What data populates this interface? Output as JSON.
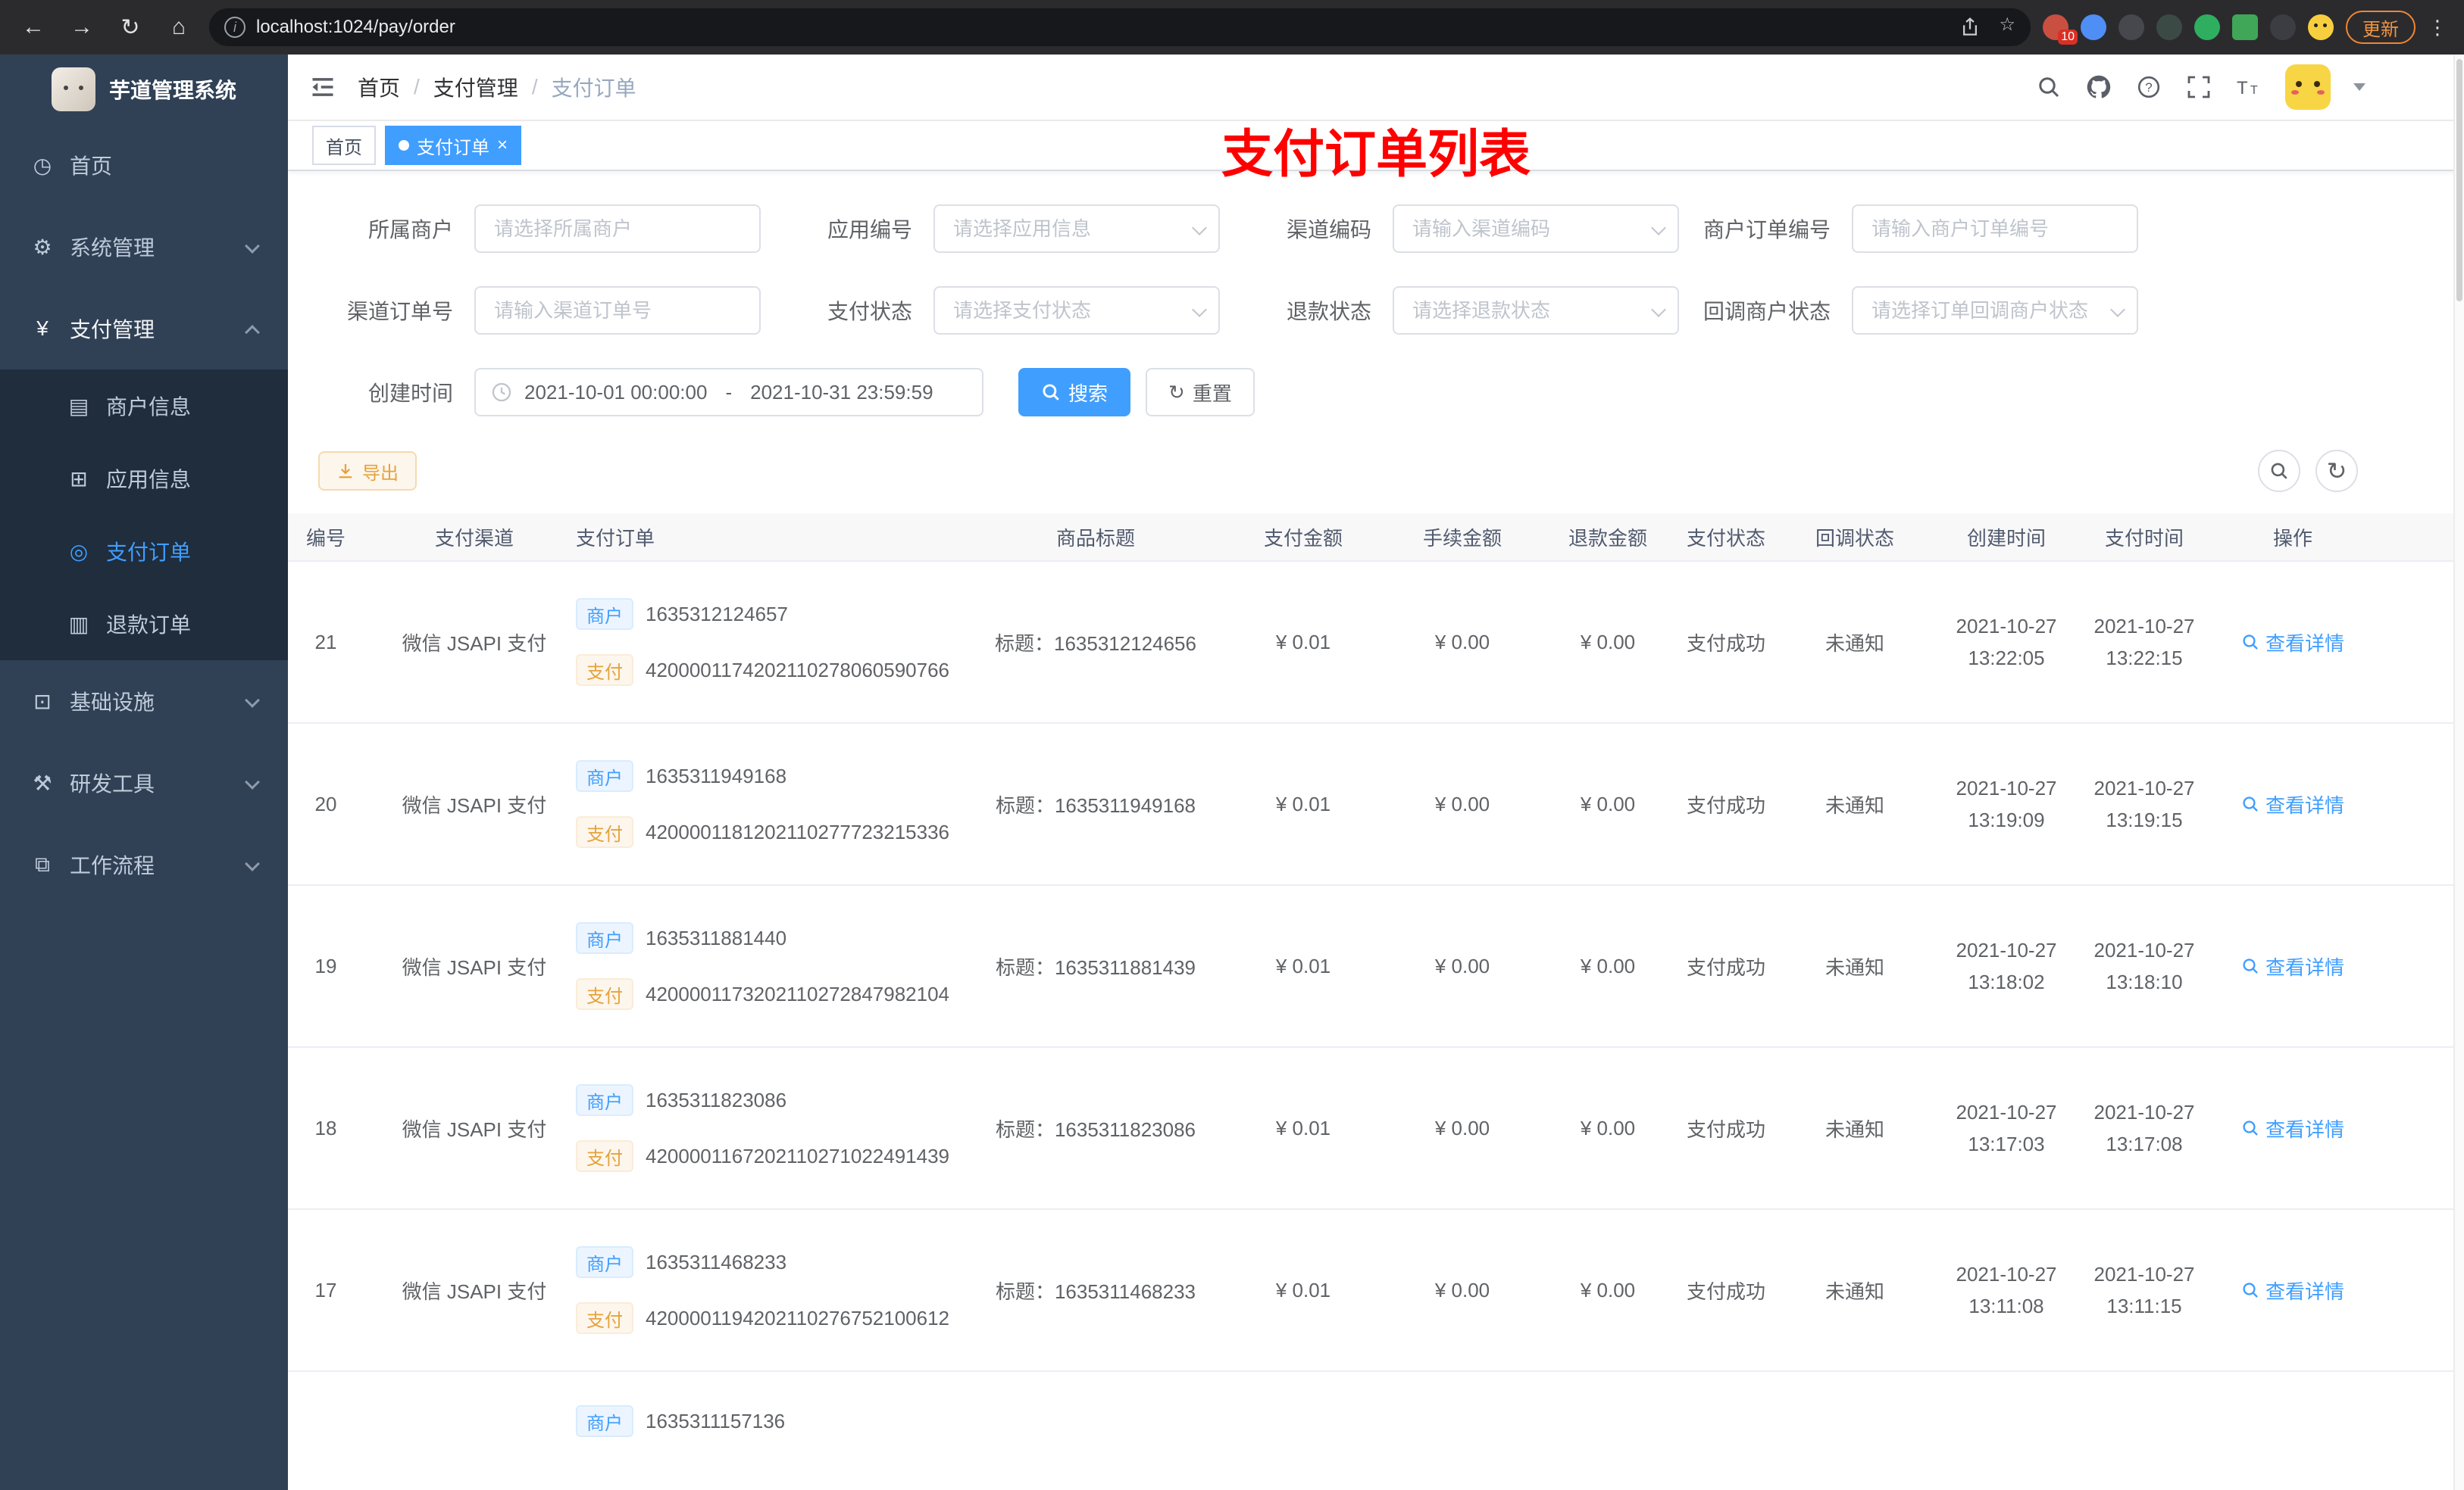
{
  "browser": {
    "url": "localhost:1024/pay/order",
    "update_label": "更新",
    "extension_badge": "10"
  },
  "sidebar": {
    "title": "芋道管理系统",
    "menu": [
      {
        "label": "首页"
      },
      {
        "label": "系统管理"
      },
      {
        "label": "支付管理"
      },
      {
        "label": "基础设施"
      },
      {
        "label": "研发工具"
      },
      {
        "label": "工作流程"
      }
    ],
    "submenu": [
      {
        "label": "商户信息"
      },
      {
        "label": "应用信息"
      },
      {
        "label": "支付订单"
      },
      {
        "label": "退款订单"
      }
    ]
  },
  "navbar": {
    "breadcrumb": [
      "首页",
      "支付管理",
      "支付订单"
    ],
    "annotation": "支付订单列表"
  },
  "tabs": [
    {
      "label": "首页"
    },
    {
      "label": "支付订单"
    }
  ],
  "filters": {
    "fields": [
      {
        "label": "所属商户",
        "placeholder": "请选择所属商户"
      },
      {
        "label": "应用编号",
        "placeholder": "请选择应用信息"
      },
      {
        "label": "渠道编码",
        "placeholder": "请输入渠道编码"
      },
      {
        "label": "商户订单编号",
        "placeholder": "请输入商户订单编号"
      },
      {
        "label": "渠道订单号",
        "placeholder": "请输入渠道订单号"
      },
      {
        "label": "支付状态",
        "placeholder": "请选择支付状态"
      },
      {
        "label": "退款状态",
        "placeholder": "请选择退款状态"
      },
      {
        "label": "回调商户状态",
        "placeholder": "请选择订单回调商户状态"
      }
    ],
    "create_time_label": "创建时间",
    "date_start": "2021-10-01 00:00:00",
    "date_separator": "-",
    "date_end": "2021-10-31 23:59:59",
    "search_label": "搜索",
    "reset_label": "重置",
    "export_label": "导出"
  },
  "table": {
    "columns": [
      "编号",
      "支付渠道",
      "支付订单",
      "商品标题",
      "支付金额",
      "手续金额",
      "退款金额",
      "支付状态",
      "回调状态",
      "创建时间",
      "支付时间",
      "操作"
    ],
    "merchant_tag": "商户",
    "pay_tag": "支付",
    "action_label": "查看详情",
    "rows": [
      {
        "id": "21",
        "channel": "微信 JSAPI 支付",
        "merchant_no": "1635312124657",
        "pay_no": "4200001174202110278060590766",
        "title": "标题：1635312124656",
        "amount": "¥ 0.01",
        "fee": "¥ 0.00",
        "refund": "¥ 0.00",
        "status": "支付成功",
        "notify_status": "未通知",
        "create_date": "2021-10-27",
        "create_time": "13:22:05",
        "pay_date": "2021-10-27",
        "pay_time": "13:22:15"
      },
      {
        "id": "20",
        "channel": "微信 JSAPI 支付",
        "merchant_no": "1635311949168",
        "pay_no": "4200001181202110277723215336",
        "title": "标题：1635311949168",
        "amount": "¥ 0.01",
        "fee": "¥ 0.00",
        "refund": "¥ 0.00",
        "status": "支付成功",
        "notify_status": "未通知",
        "create_date": "2021-10-27",
        "create_time": "13:19:09",
        "pay_date": "2021-10-27",
        "pay_time": "13:19:15"
      },
      {
        "id": "19",
        "channel": "微信 JSAPI 支付",
        "merchant_no": "1635311881440",
        "pay_no": "4200001173202110272847982104",
        "title": "标题：1635311881439",
        "amount": "¥ 0.01",
        "fee": "¥ 0.00",
        "refund": "¥ 0.00",
        "status": "支付成功",
        "notify_status": "未通知",
        "create_date": "2021-10-27",
        "create_time": "13:18:02",
        "pay_date": "2021-10-27",
        "pay_time": "13:18:10"
      },
      {
        "id": "18",
        "channel": "微信 JSAPI 支付",
        "merchant_no": "1635311823086",
        "pay_no": "4200001167202110271022491439",
        "title": "标题：1635311823086",
        "amount": "¥ 0.01",
        "fee": "¥ 0.00",
        "refund": "¥ 0.00",
        "status": "支付成功",
        "notify_status": "未通知",
        "create_date": "2021-10-27",
        "create_time": "13:17:03",
        "pay_date": "2021-10-27",
        "pay_time": "13:17:08"
      },
      {
        "id": "17",
        "channel": "微信 JSAPI 支付",
        "merchant_no": "1635311468233",
        "pay_no": "4200001194202110276752100612",
        "title": "标题：1635311468233",
        "amount": "¥ 0.01",
        "fee": "¥ 0.00",
        "refund": "¥ 0.00",
        "status": "支付成功",
        "notify_status": "未通知",
        "create_date": "2021-10-27",
        "create_time": "13:11:08",
        "pay_date": "2021-10-27",
        "pay_time": "13:11:15"
      }
    ],
    "partial_row": {
      "merchant_no": "1635311157136"
    }
  }
}
